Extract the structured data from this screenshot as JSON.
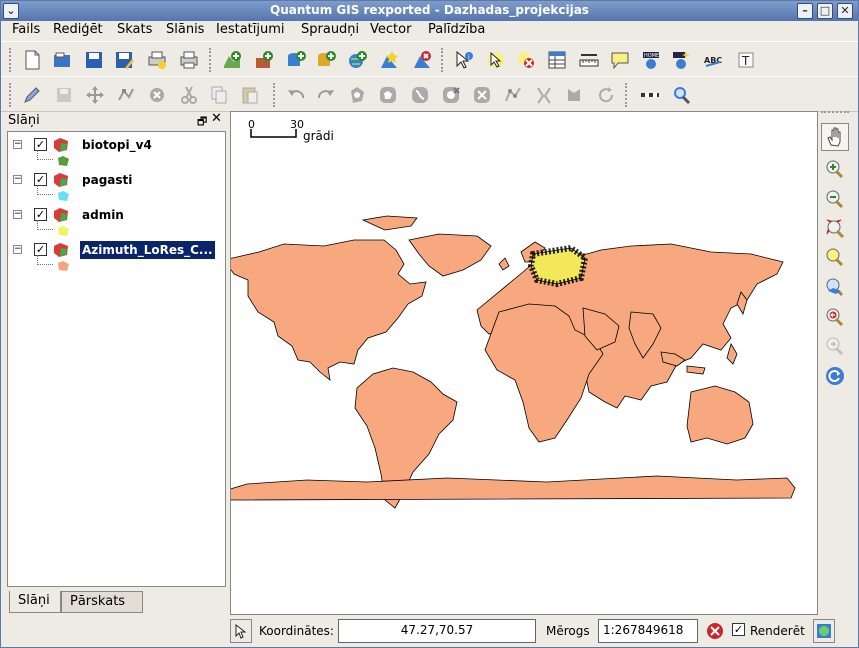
{
  "window": {
    "title": "Quantum GIS rexported - Dazhadas_projekcijas",
    "menu_icon": "chevron-down-icon",
    "controls": [
      "minimize-icon",
      "maximize-icon",
      "close-icon"
    ]
  },
  "menubar": {
    "items": [
      "Fails",
      "Rediģēt",
      "Skats",
      "Slānis",
      "Iestatījumi",
      "Spraudņi",
      "Vector",
      "Palīdzība"
    ]
  },
  "toolbar1": {
    "icons": [
      "new-project-icon",
      "open-project-icon",
      "save-project-icon",
      "save-as-icon",
      "print-composer-icon",
      "print-icon",
      "add-vector-layer-icon",
      "add-raster-layer-icon",
      "add-postgis-layer-icon",
      "add-spatialite-layer-icon",
      "add-wms-layer-icon",
      "new-vector-layer-icon",
      "remove-layer-icon",
      "identify-icon",
      "select-icon",
      "deselect-icon",
      "attribute-table-icon",
      "measure-icon",
      "map-tips-icon",
      "home-icon",
      "new-bookmark-icon",
      "label-icon",
      "text-annotation-icon"
    ]
  },
  "toolbar2": {
    "icons": [
      "toggle-edit-icon",
      "save-edits-icon",
      "move-feature-icon",
      "node-tool-icon",
      "delete-selected-icon",
      "cut-icon",
      "copy-icon",
      "paste-icon",
      "undo-icon",
      "redo-icon",
      "add-ring-icon",
      "add-island-icon",
      "simplify-icon",
      "delete-ring-icon",
      "delete-part-icon",
      "reshape-icon",
      "split-icon",
      "merge-icon",
      "rotate-icon",
      "offset-icon",
      "scale-bar-icon",
      "zoom-pan-icon"
    ]
  },
  "legend": {
    "title": "Slāņi",
    "float_icon": "float-icon",
    "close_icon": "close-icon",
    "layers": [
      {
        "name": "biotopi_v4",
        "checked": true,
        "symbol_color": "#5a9a3c",
        "selected": false
      },
      {
        "name": "pagasti",
        "checked": true,
        "symbol_color": "#66e0ee",
        "selected": false
      },
      {
        "name": "admin",
        "checked": true,
        "symbol_color": "#f2f266",
        "selected": false
      },
      {
        "name": "Azimuth_LoRes_C...",
        "checked": true,
        "symbol_color": "#f4a57e",
        "selected": true
      }
    ],
    "tabs": [
      "Slāņi",
      "Pārskats"
    ]
  },
  "map": {
    "scalebar": {
      "min_label": "0",
      "max_label": "30",
      "unit": "grādi"
    },
    "land_color": "#f8a87f",
    "highlight_color": "#f3e85a"
  },
  "right_tools": {
    "icons": [
      "pan-icon",
      "zoom-in-icon",
      "zoom-out-icon",
      "zoom-full-icon",
      "zoom-selection-icon",
      "zoom-layer-icon",
      "zoom-last-icon",
      "zoom-next-icon",
      "refresh-icon"
    ]
  },
  "statusbar": {
    "coords_label": "Koordinātes:",
    "coords_value": "47.27,70.57",
    "scale_label": "Mērogs",
    "scale_value": "1:267849618",
    "render_label": "Renderēt",
    "render_checked": true
  }
}
